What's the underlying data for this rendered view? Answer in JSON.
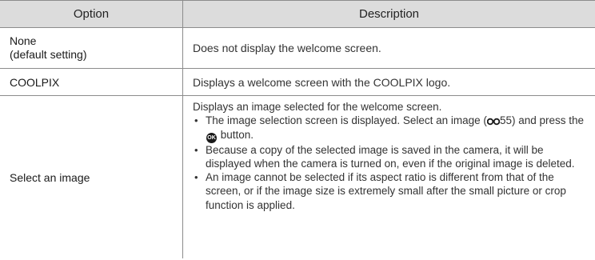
{
  "header": {
    "option": "Option",
    "description": "Description"
  },
  "rows": [
    {
      "option_line1": "None",
      "option_line2": "(default setting)",
      "description": "Does not display the welcome screen."
    },
    {
      "option": "COOLPIX",
      "description": "Displays a welcome screen with the COOLPIX logo."
    },
    {
      "option": "Select an image",
      "intro": "Displays an image selected for the welcome screen.",
      "bullet1_before": "The image selection screen is displayed. Select an image (",
      "bullet1_ref": "55",
      "bullet1_mid": ") and press the",
      "bullet1_after": "button.",
      "bullet2": "Because a copy of the selected image is saved in the camera, it will be displayed when the camera is turned on, even if the original image is deleted.",
      "bullet3": "An image cannot be selected if its aspect ratio is different from that of the screen, or if the image size is extremely small after the small picture or crop function is applied."
    }
  ],
  "icons": {
    "reference": "reference-link-icon",
    "ok_button": "ok-button-icon",
    "ok_label": "OK"
  }
}
